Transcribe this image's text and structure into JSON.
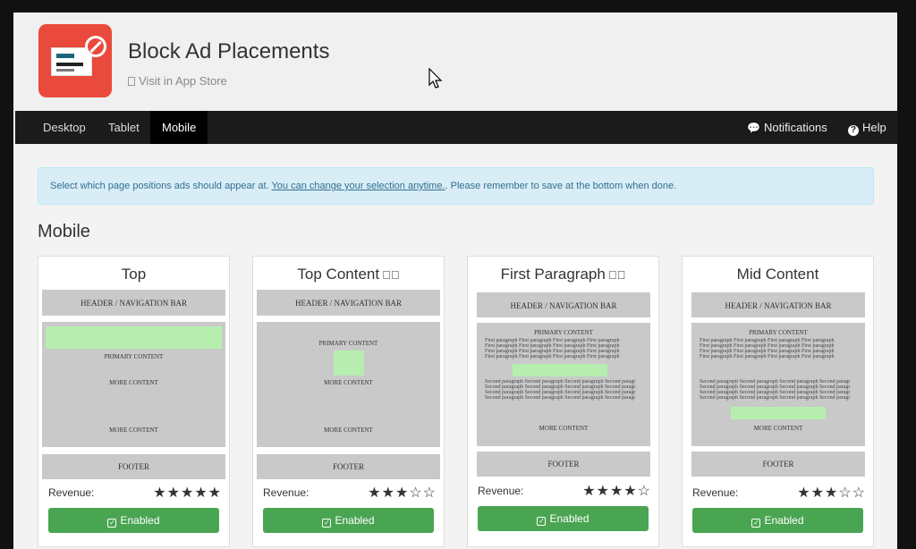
{
  "app": {
    "title": "Block Ad Placements",
    "store_link": "Visit in App Store"
  },
  "nav": {
    "tabs": [
      {
        "label": "Desktop",
        "active": false
      },
      {
        "label": "Tablet",
        "active": false
      },
      {
        "label": "Mobile",
        "active": true
      }
    ],
    "notifications": "Notifications",
    "help": "Help"
  },
  "alert": {
    "text_before": "Select which page positions ads should appear at. ",
    "link": "You can change your selection anytime.",
    "text_after": ". Please remember to save at the bottom when done."
  },
  "section_title": "Mobile",
  "common": {
    "header_bar": "HEADER / NAVIGATION BAR",
    "primary_content": "PRIMARY CONTENT",
    "more_content": "MORE CONTENT",
    "footer": "FOOTER",
    "first_para": "First paragraph First paragraph First paragraph First paragraph",
    "second_para": "Second paragraph Second paragraph Second paragraph Second paragr",
    "revenue_label": "Revenue:",
    "enabled_label": "Enabled"
  },
  "cards": [
    {
      "title": "Top",
      "has_person_icon": false,
      "revenue_stars": 5,
      "stars_text": "★★★★★",
      "status": "Enabled"
    },
    {
      "title": "Top Content",
      "has_person_icon": true,
      "revenue_stars": 3,
      "stars_text": "★★★☆☆",
      "status": "Enabled"
    },
    {
      "title": "First Paragraph",
      "has_person_icon": true,
      "revenue_stars": 4,
      "stars_text": "★★★★☆",
      "status": "Enabled"
    },
    {
      "title": "Mid Content",
      "has_person_icon": false,
      "revenue_stars": 3,
      "stars_text": "★★★☆☆",
      "status": "Enabled"
    }
  ],
  "colors": {
    "app_icon": "#ea4a3c",
    "navbar": "#1b1b1b",
    "alert_bg": "#d9edf7",
    "ad_slot": "#b7eeb0",
    "enabled_button": "#4aa552"
  },
  "icons": {
    "notifications": "chat-bubbles-icon",
    "help": "question-circle-icon",
    "store": "mobile-phone-icon",
    "enabled": "checkbox-icon",
    "person_blocked": "person-blocked-icon"
  }
}
